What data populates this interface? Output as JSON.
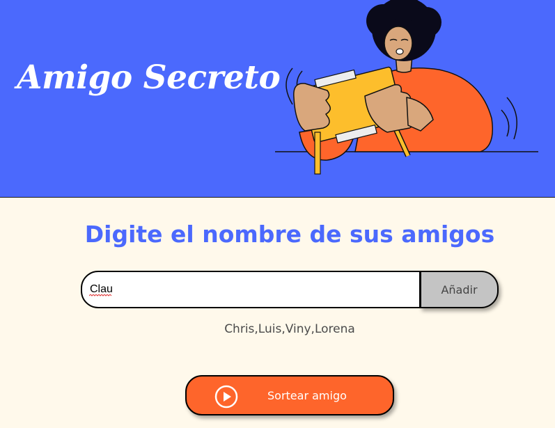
{
  "header": {
    "title": "Amigo Secreto",
    "background": "#4B69FD",
    "illustration": "person-holding-gift-box-illustration"
  },
  "main": {
    "subtitle": "Digite el nombre de sus amigos",
    "input": {
      "value": "Clau",
      "placeholder": ""
    },
    "add_button_label": "Añadir",
    "friends_list": "Chris,Luis,Viny,Lorena",
    "draw_button_label": "Sortear amigo",
    "draw_button_icon": "play-circle-icon"
  },
  "colors": {
    "accent": "#4B69FD",
    "button": "#FE652B",
    "background": "#FFF9EB",
    "add_button": "#C4C4C4"
  }
}
